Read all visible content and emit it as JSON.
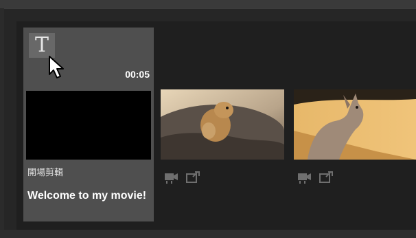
{
  "timeline": {
    "clips": [
      {
        "kind": "title",
        "icon": "title-text-icon",
        "icon_glyph": "T",
        "duration": "00:05",
        "name": "開場剪輯",
        "title_text": "Welcome to my movie!"
      },
      {
        "kind": "video",
        "thumbnail": "prairie-dog-on-rock",
        "icons": [
          "video-camera-icon",
          "clip-transition-icon"
        ]
      },
      {
        "kind": "video",
        "thumbnail": "wallaby-in-sun",
        "icons": [
          "video-camera-icon",
          "clip-transition-icon"
        ]
      }
    ]
  },
  "colors": {
    "selected_clip_bg": "#4f4f4f",
    "timeline_bg": "#1f1f1f"
  }
}
